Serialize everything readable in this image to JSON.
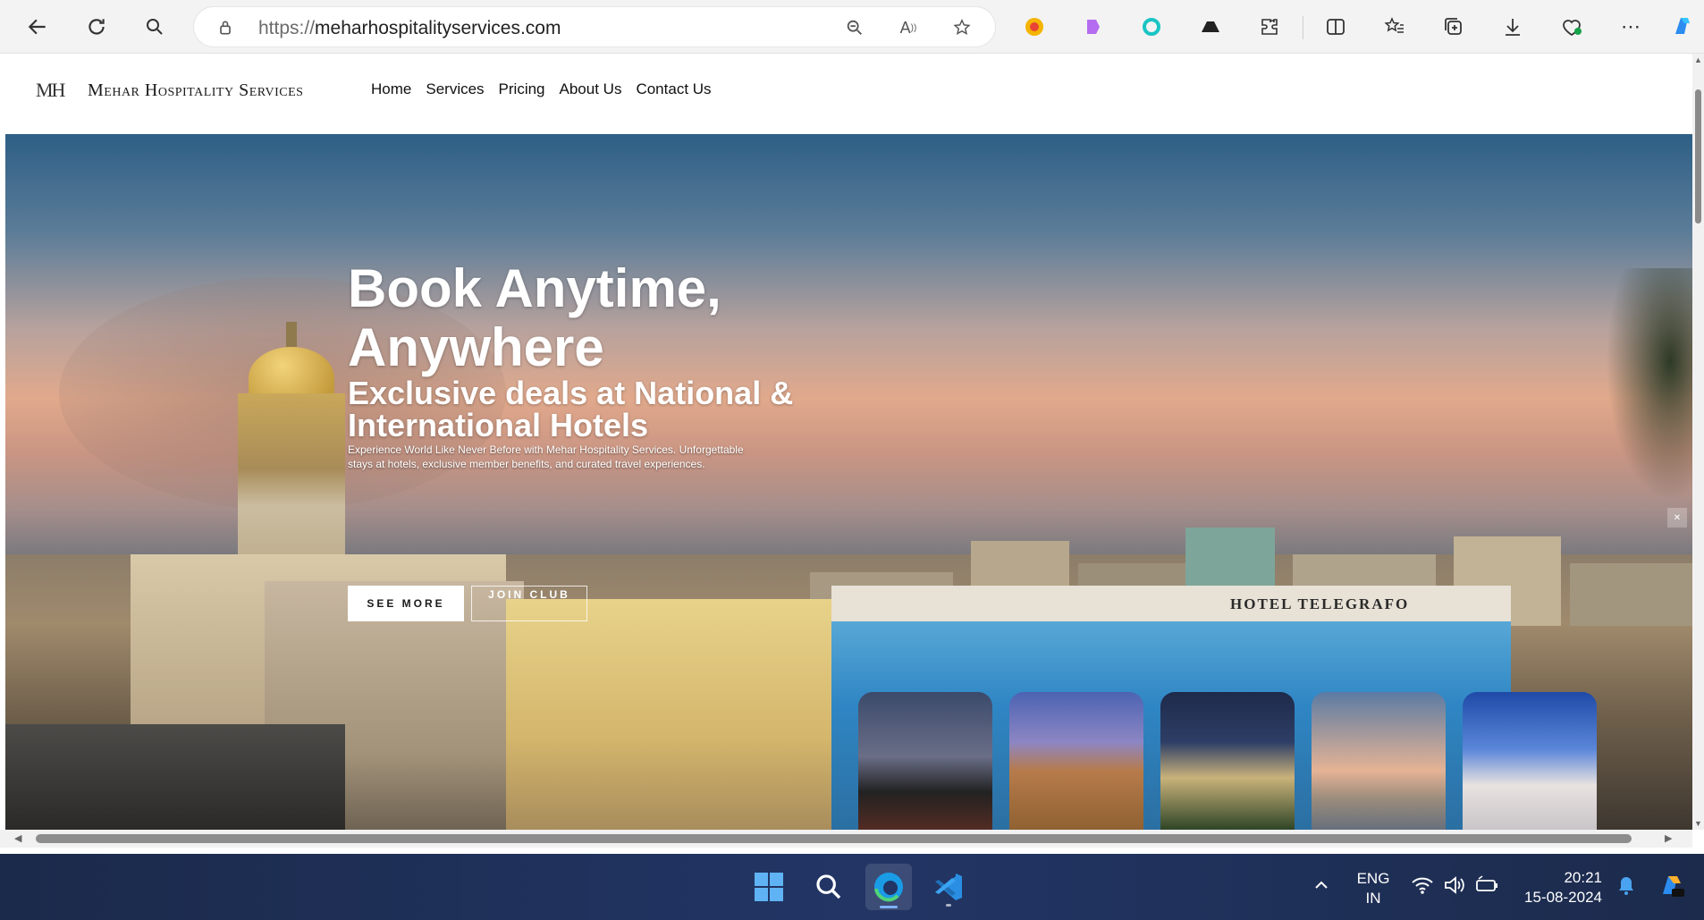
{
  "browser": {
    "url_scheme": "https://",
    "url_host": "meharhospitalityservices.com"
  },
  "site": {
    "logo_text": "MH",
    "brand": "Mehar Hospitality Services",
    "menu": [
      "Home",
      "Services",
      "Pricing",
      "About Us",
      "Contact Us"
    ]
  },
  "hero": {
    "title": "Book Anytime, Anywhere",
    "subtitle": "Exclusive deals at National & International Hotels",
    "description": "Experience World Like Never Before with Mehar Hospitality Services. Unforgettable stays at hotels, exclusive member benefits, and curated travel experiences.",
    "btn_see_more": "SEE MORE",
    "btn_join": "JOIN CLUB",
    "hotel_sign": "HOTEL TELEGRAFO"
  },
  "taskbar": {
    "lang_line1": "ENG",
    "lang_line2": "IN",
    "time": "20:21",
    "date": "15-08-2024"
  },
  "colors": {
    "taskbar_bg": "#223565",
    "page_bg": "#ffffff",
    "button_bg": "#ffffff"
  }
}
